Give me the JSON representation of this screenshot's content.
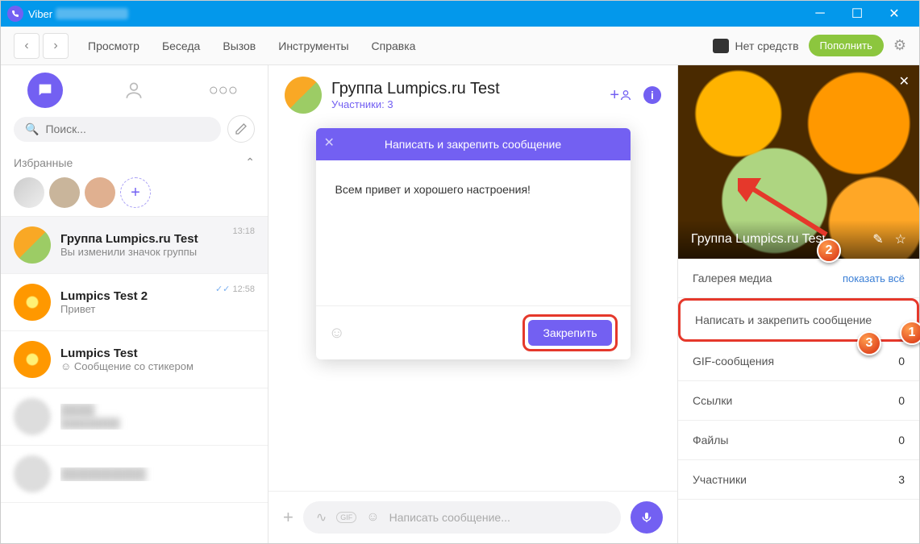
{
  "window": {
    "app": "Viber"
  },
  "menu": {
    "view": "Просмотр",
    "chat": "Беседа",
    "call": "Вызов",
    "tools": "Инструменты",
    "help": "Справка"
  },
  "toolbar": {
    "balance": "Нет средств",
    "topup": "Пополнить"
  },
  "search": {
    "placeholder": "Поиск..."
  },
  "favorites": {
    "label": "Избранные"
  },
  "chats": [
    {
      "name": "Группа Lumpics.ru Test",
      "preview": "Вы изменили значок группы",
      "time": "13:18",
      "avatar": "citrus",
      "selected": true
    },
    {
      "name": "Lumpics Test 2",
      "preview": "Привет",
      "time": "12:58",
      "avatar": "orange",
      "checks": "✓✓"
    },
    {
      "name": "Lumpics Test",
      "preview": "☺ Сообщение со стикером",
      "time": "",
      "avatar": "orange"
    }
  ],
  "chat_header": {
    "title": "Группа Lumpics.ru Test",
    "subtitle": "Участники: 3"
  },
  "pin_modal": {
    "title": "Написать и закрепить сообщение",
    "text": "Всем привет и хорошего настроения!",
    "button": "Закрепить"
  },
  "compose": {
    "placeholder": "Написать сообщение..."
  },
  "info_panel": {
    "title": "Группа Lumpics.ru Test",
    "gallery_label": "Галерея медиа",
    "gallery_link": "показать всё",
    "pin_row": "Написать и закрепить сообщение",
    "gif_label": "GIF-сообщения",
    "gif_count": "0",
    "links_label": "Ссылки",
    "links_count": "0",
    "files_label": "Файлы",
    "files_count": "0",
    "members_label": "Участники",
    "members_count": "3"
  },
  "badges": {
    "b1": "1",
    "b2": "2",
    "b3": "3"
  }
}
